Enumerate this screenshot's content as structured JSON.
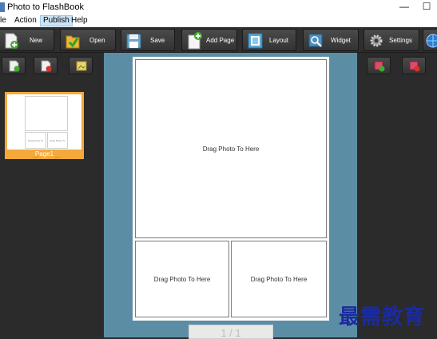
{
  "window": {
    "title": "Photo to FlashBook",
    "minimize_glyph": "—",
    "maximize_glyph": "☐"
  },
  "menu": {
    "items": [
      "le",
      "Action",
      "Publish",
      "Help"
    ],
    "active": "Publish"
  },
  "toolbar": {
    "new_label": "New",
    "open_label": "Open",
    "save_label": "Save",
    "add_page_label": "Add Page",
    "layout_label": "Layout",
    "widget_label": "Widget",
    "settings_label": "Settings"
  },
  "left_panel": {
    "thumbnail_label": "Page1",
    "thumb_cell_text": "Drag Photo To Here"
  },
  "canvas": {
    "slot_text": "Drag Photo To Here",
    "pager_text": "1 / 1"
  },
  "watermark": "最需教育",
  "colors": {
    "canvas_bg": "#5b8ea4",
    "panel_bg": "#2b2b2b",
    "thumb_selected": "#f5a93a",
    "watermark": "#1b2b9f"
  }
}
